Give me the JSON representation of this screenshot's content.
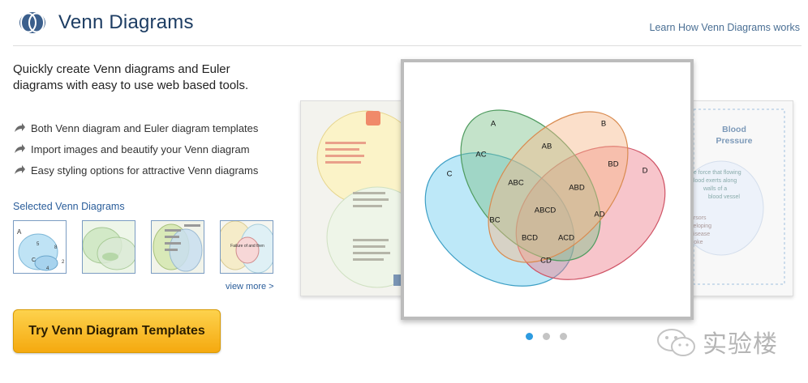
{
  "header": {
    "brand": "Venn Diagrams",
    "learn_link": "Learn How Venn Diagrams works"
  },
  "intro": {
    "text": "Quickly create Venn diagrams and Euler diagrams with easy to use web based tools."
  },
  "features": [
    {
      "label": "Both Venn diagram and Euler diagram templates",
      "icon": "arrow-icon"
    },
    {
      "label": "Import images and beautify your Venn diagram",
      "icon": "arrow-icon"
    },
    {
      "label": "Easy styling options for attractive Venn diagrams",
      "icon": "arrow-icon"
    }
  ],
  "selected": {
    "title": "Selected Venn Diagrams",
    "view_more": "view more >",
    "thumb1_labels": [
      "A",
      "5",
      "8",
      "C",
      "4",
      "2"
    ],
    "thumb4_label": "Failure of and then"
  },
  "cta": {
    "label": "Try Venn Diagram Templates"
  },
  "carousel": {
    "main_labels": {
      "A": "A",
      "B": "B",
      "C": "C",
      "D": "D",
      "AB": "AB",
      "AC": "AC",
      "BD": "BD",
      "ABC": "ABC",
      "ABD": "ABD",
      "ABCD": "ABCD",
      "BC": "BC",
      "AD": "AD",
      "BCD": "BCD",
      "ACD": "ACD",
      "CD": "CD"
    },
    "right_slide": {
      "title_line1": "Blood",
      "title_line2": "Pressure",
      "text1": "he force that flowing",
      "text2": "blood exerts along",
      "text3": "walls of a",
      "text4": "blood vessel",
      "text5": "ursors",
      "text6": "veloping",
      "text7": "disease",
      "text8": "troke"
    },
    "dots": [
      {
        "active": true
      },
      {
        "active": false
      },
      {
        "active": false
      }
    ],
    "colors": {
      "active_dot": "#2d9be0",
      "inactive_dot": "#c4c4c4",
      "set_A": "#7cc08a",
      "set_B": "#f7b98a",
      "set_C": "#6ccbef",
      "set_D": "#ee7f8c"
    }
  },
  "watermark": {
    "text": "实验楼"
  }
}
